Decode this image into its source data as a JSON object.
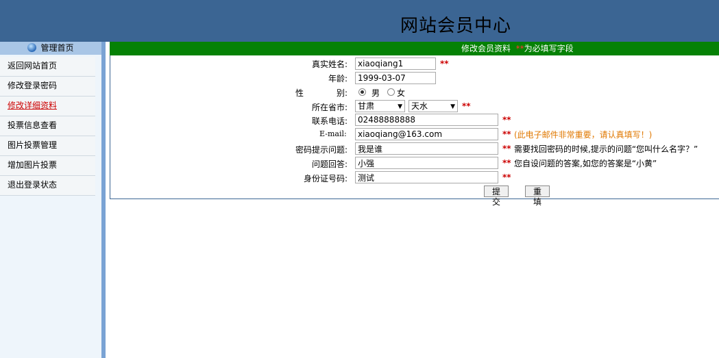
{
  "header": {
    "title": "网站会员中心"
  },
  "sidebar": {
    "heading": "管理首页",
    "items": [
      {
        "label": "返回网站首页"
      },
      {
        "label": "修改登录密码"
      },
      {
        "label": "修改详细资料"
      },
      {
        "label": "投票信息查看"
      },
      {
        "label": "图片投票管理"
      },
      {
        "label": "增加图片投票"
      },
      {
        "label": "退出登录状态"
      }
    ]
  },
  "form": {
    "heading": "修改会员资料",
    "required_mark": "**",
    "required_note": "为必填写字段",
    "real_name": {
      "label": "真实姓名:",
      "value": "xiaoqiang1"
    },
    "age": {
      "label": "年龄:",
      "value": "1999-03-07"
    },
    "gender": {
      "label_a": "性",
      "label_b": "别:",
      "options": [
        "男",
        "女"
      ],
      "selected": "男"
    },
    "province": {
      "label": "所在省市:",
      "province": "甘肃",
      "city": "天水"
    },
    "phone": {
      "label": "联系电话:",
      "value": "02488888888"
    },
    "email": {
      "label": "E-mail:",
      "value": "xiaoqiang@163.com",
      "hint": "(此电子邮件非常重要，请认真填写！)"
    },
    "question": {
      "label": "密码提示问题:",
      "value": "我是谁",
      "hint": "需要找回密码的时候,提示的问题“您叫什么名字？”"
    },
    "answer": {
      "label": "问题回答:",
      "value": "小强",
      "hint": "您自设问题的答案,如您的答案是“小黄”"
    },
    "id_number": {
      "label": "身份证号码:",
      "value": "测试"
    },
    "submit_label": "提交",
    "reset_label": "重填"
  },
  "colors": {
    "header": "#3b6593",
    "bar": "#058105",
    "required": "#cc0000",
    "email_hint": "#e07800"
  }
}
